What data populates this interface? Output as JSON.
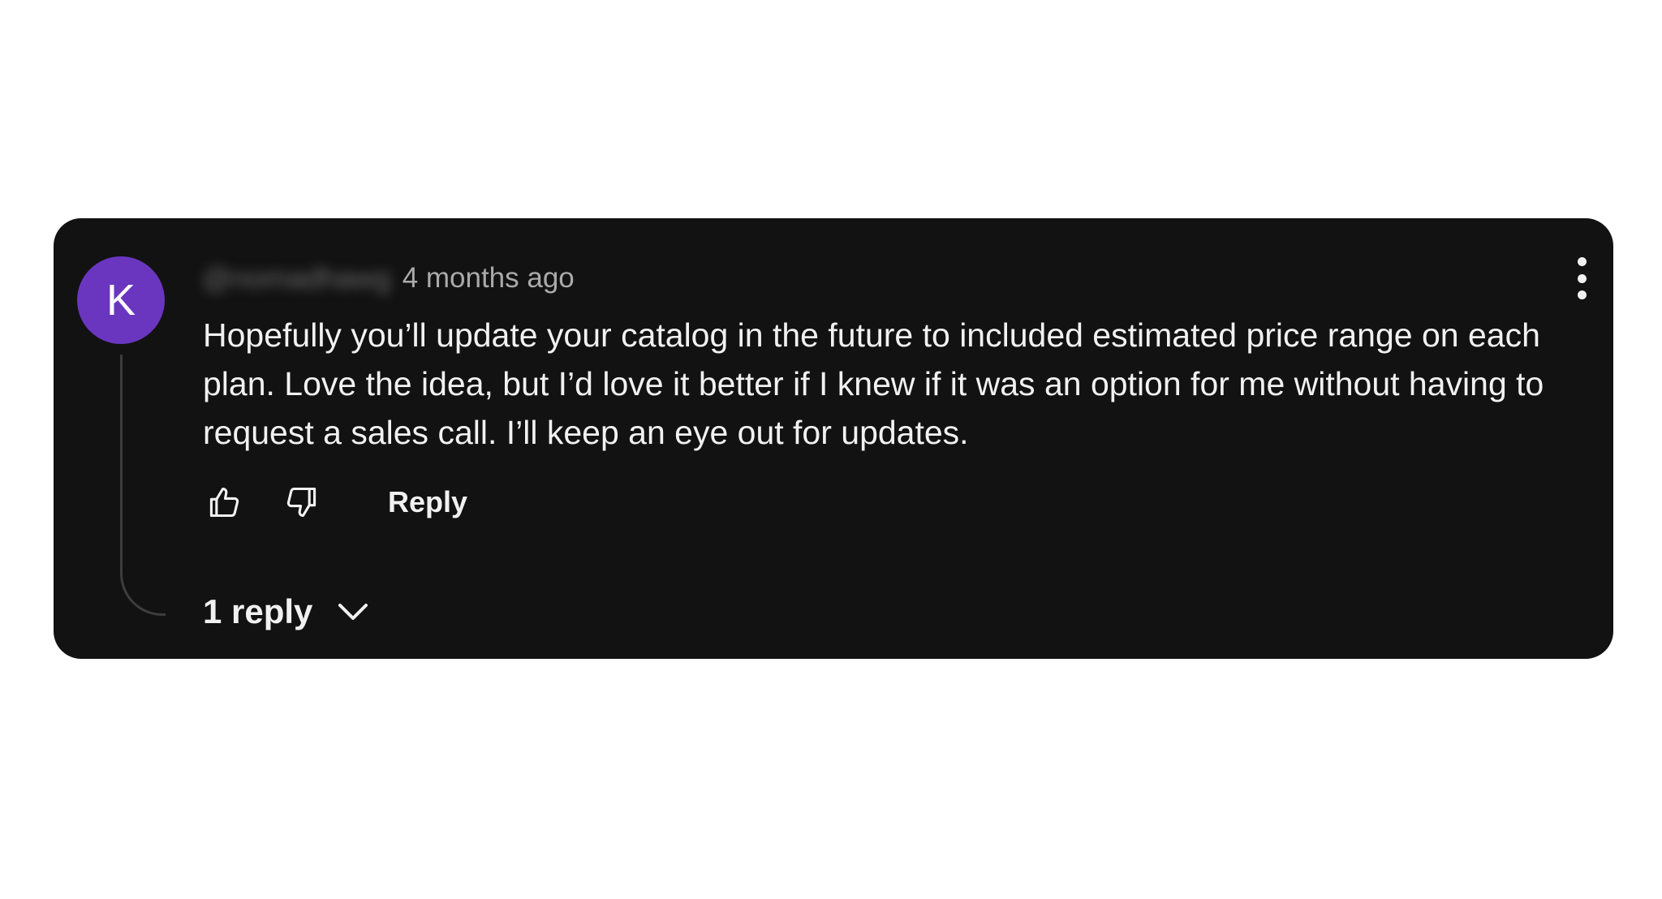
{
  "comment": {
    "avatar_letter": "K",
    "avatar_color": "#6a36c0",
    "username": "@nomadhawg",
    "timestamp": "4 months ago",
    "text": "Hopefully you’ll update your catalog in the future to included estimated price range on each plan. Love the idea, but I’d love it better if I knew if it was an option for me without having to request a sales call. I’ll keep an eye out for updates.",
    "more_icon": "more-vertical-icon"
  },
  "actions": {
    "like_icon": "thumbs-up-icon",
    "dislike_icon": "thumbs-down-icon",
    "reply_label": "Reply"
  },
  "replies": {
    "count_label": "1 reply",
    "toggle_icon": "chevron-down-icon"
  },
  "colors": {
    "card_background": "#121212",
    "text_primary": "#f1f1f1",
    "text_secondary": "#aaaaaa"
  }
}
